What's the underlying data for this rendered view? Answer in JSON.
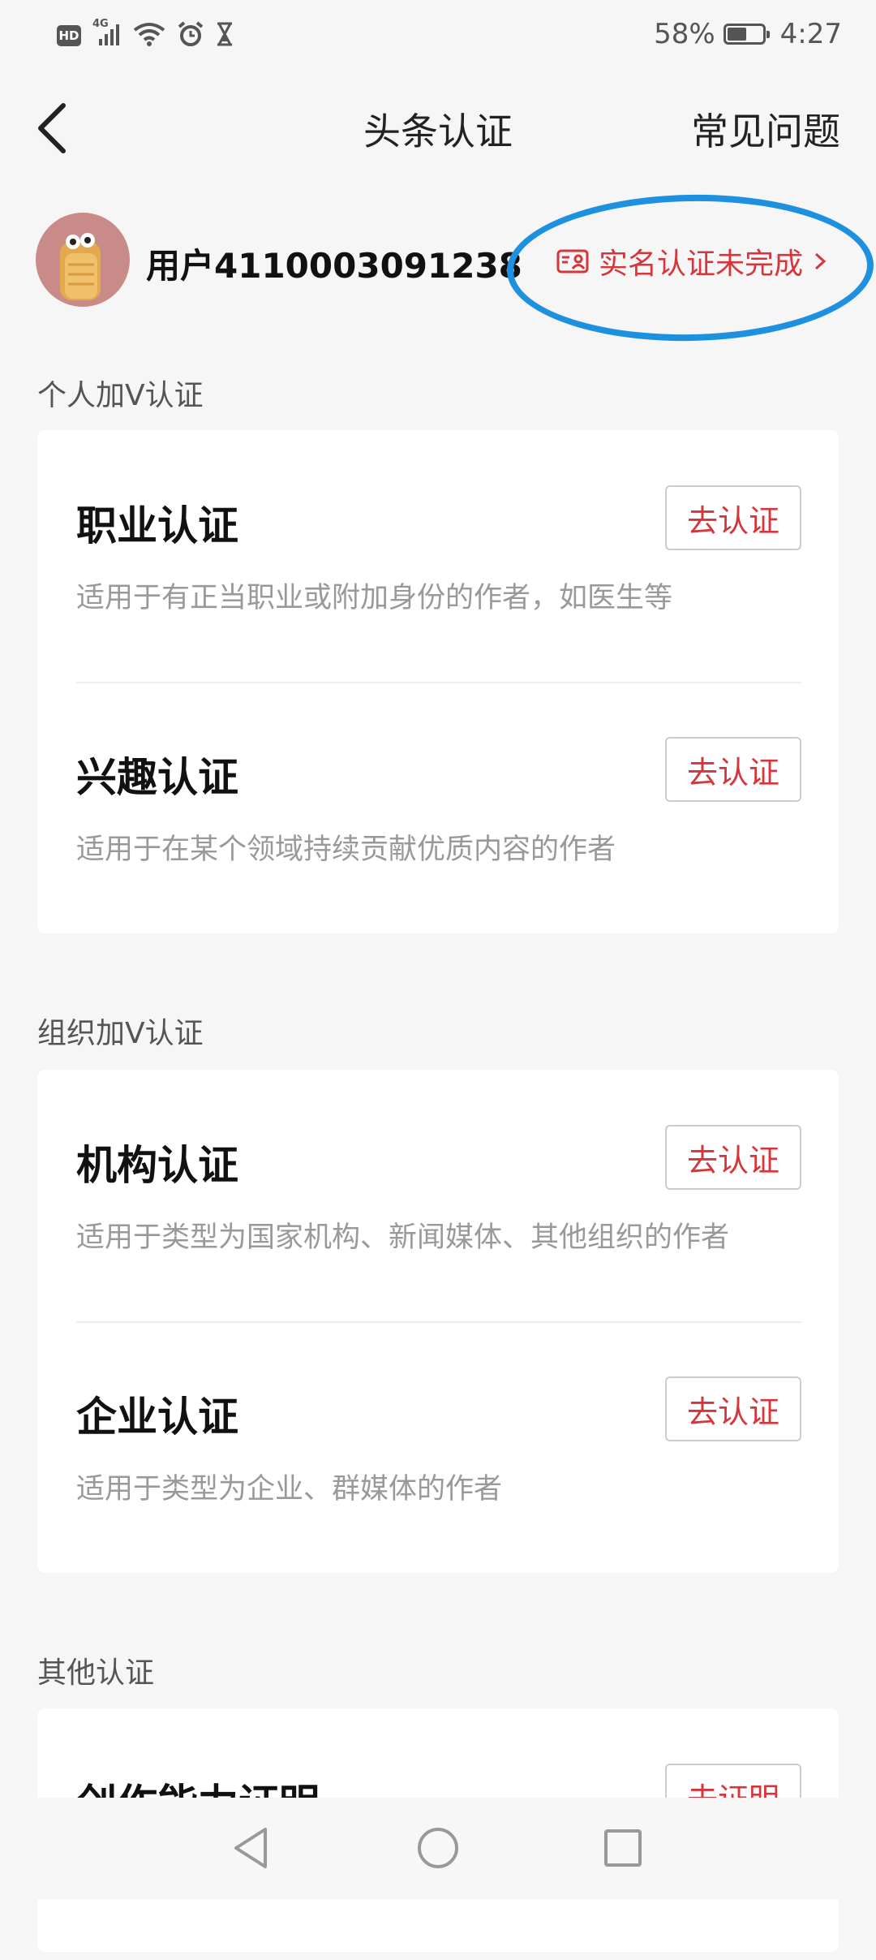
{
  "status_bar": {
    "hd": "HD",
    "network": "4G",
    "battery": "58%",
    "battery_level": 0.58,
    "time": "4:27"
  },
  "header": {
    "back_icon": "chevron-left-icon",
    "title": "头条认证",
    "faq": "常见问题"
  },
  "profile": {
    "username": "用户4110003091238",
    "realname_status": "实名认证未完成",
    "realname_icon": "id-card-icon",
    "highlight_color": "#1e90e0"
  },
  "sections": [
    {
      "label": "个人加V认证",
      "items": [
        {
          "title": "职业认证",
          "desc": "适用于有正当职业或附加身份的作者，如医生等",
          "button": "去认证"
        },
        {
          "title": "兴趣认证",
          "desc": "适用于在某个领域持续贡献优质内容的作者",
          "button": "去认证"
        }
      ]
    },
    {
      "label": "组织加V认证",
      "items": [
        {
          "title": "机构认证",
          "desc": "适用于类型为国家机构、新闻媒体、其他组织的作者",
          "button": "去认证"
        },
        {
          "title": "企业认证",
          "desc": "适用于类型为企业、群媒体的作者",
          "button": "去认证"
        }
      ]
    },
    {
      "label": "其他认证",
      "items": [
        {
          "title": "创作能力证明",
          "button": "去证明"
        }
      ]
    }
  ],
  "colors": {
    "accent": "#d6363b",
    "background": "#f6f6f6"
  },
  "system_nav": [
    "back-triangle-icon",
    "home-circle-icon",
    "recents-square-icon"
  ]
}
